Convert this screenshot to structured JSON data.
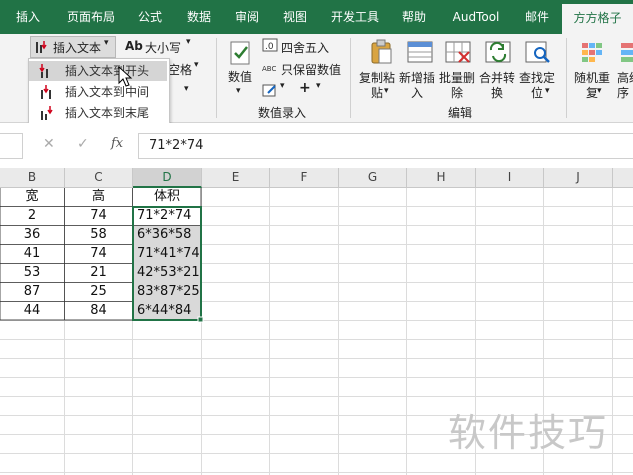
{
  "tabs": [
    "插入",
    "页面布局",
    "公式",
    "数据",
    "审阅",
    "视图",
    "开发工具",
    "帮助",
    "AudTool",
    "邮件",
    "方方格子"
  ],
  "ribbon": {
    "insert_text_label": "插入文本",
    "case_label": "大小写",
    "case_prefix": "Ab",
    "space_label": "空格",
    "round_label": "四舍五入",
    "keep_value_label": "只保留数值",
    "numeric_label": "数值",
    "value_entry_group": "数值录入",
    "copy_paste_label": [
      "复制粘",
      "贴"
    ],
    "add_insert_label": [
      "新增插",
      "入"
    ],
    "batch_delete_label": [
      "批量删",
      "除"
    ],
    "merge_convert_label": [
      "合并转",
      "换"
    ],
    "find_locate_label": [
      "查找定",
      "位"
    ],
    "edit_group": "编辑",
    "random_repeat_label": [
      "随机重",
      "复"
    ],
    "advanced_sort_label": [
      "高级",
      "序"
    ]
  },
  "dropdown": {
    "items": [
      "插入文本到开头",
      "插入文本到中间",
      "插入文本到末尾"
    ]
  },
  "formula_bar": {
    "fx": "fx",
    "content": "71*2*74"
  },
  "sheet": {
    "columns": [
      "B",
      "C",
      "D",
      "E",
      "F",
      "G",
      "H",
      "I",
      "J"
    ],
    "rows": [
      [
        "宽",
        "高",
        "体积"
      ],
      [
        "2",
        "74",
        "71*2*74"
      ],
      [
        "36",
        "58",
        "6*36*58"
      ],
      [
        "41",
        "74",
        "71*41*74"
      ],
      [
        "53",
        "21",
        "42*53*21"
      ],
      [
        "87",
        "25",
        "83*87*25"
      ],
      [
        "44",
        "84",
        "6*44*84"
      ]
    ]
  },
  "watermark": "软件技巧",
  "colors": {
    "accent": "#217346",
    "selection": "#d9d9d9"
  }
}
